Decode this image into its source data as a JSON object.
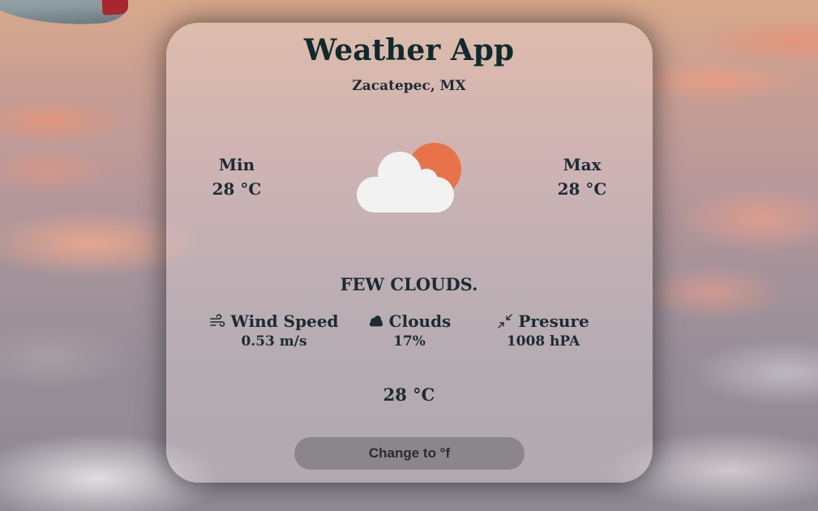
{
  "app": {
    "title": "Weather App",
    "location": "Zacatepec, MX"
  },
  "temperature": {
    "min_label": "Min",
    "min_value": "28 °C",
    "max_label": "Max",
    "max_value": "28 °C",
    "current": "28 °C"
  },
  "weather": {
    "icon": "few-clouds-day-icon",
    "description": "FEW CLOUDS."
  },
  "stats": {
    "wind": {
      "icon": "wind-icon",
      "label": "Wind Speed",
      "value": "0.53 m/s"
    },
    "clouds": {
      "icon": "cloud-icon",
      "label": "Clouds",
      "value": "17%"
    },
    "pressure": {
      "icon": "compress-arrows-icon",
      "label": "Presure",
      "value": "1008 hPA"
    }
  },
  "actions": {
    "toggle_units_label": "Change to °f"
  },
  "colors": {
    "sun": "#e8734a",
    "cloud": "#f2f2f2",
    "title_text": "#0f2a2c",
    "body_text": "#1c2b33",
    "button_bg": "#6c686a"
  }
}
